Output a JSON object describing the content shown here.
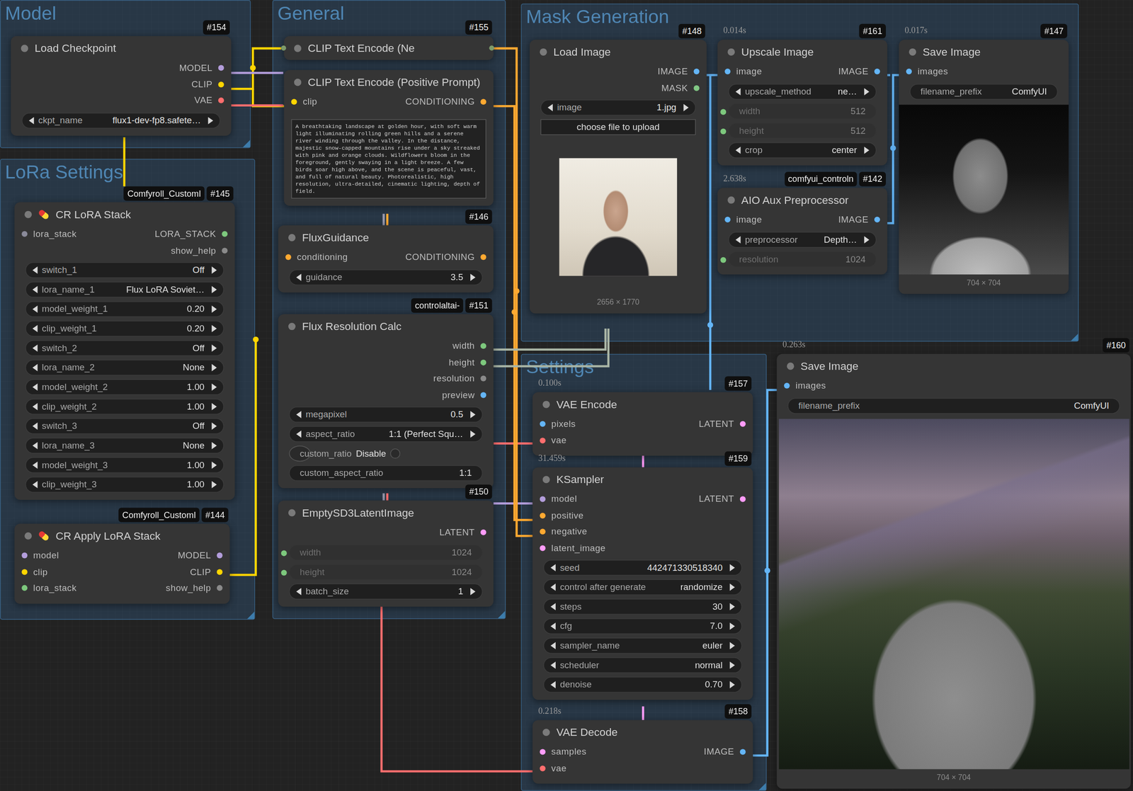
{
  "groups": [
    {
      "title": "Model"
    },
    {
      "title": "LoRa Settings"
    },
    {
      "title": "General"
    },
    {
      "title": "Mask Generation"
    },
    {
      "title": "Settings"
    }
  ],
  "nodes": [
    {
      "id": "#154",
      "title": "Load Checkpoint",
      "time": null,
      "source": null,
      "collapsed": false,
      "hasIcon": false,
      "slots": [
        {
          "in": null,
          "inColor": null,
          "out": "MODEL",
          "outColor": "#b39ddb"
        },
        {
          "in": null,
          "inColor": null,
          "out": "CLIP",
          "outColor": "#ffd500"
        },
        {
          "in": null,
          "inColor": null,
          "out": "VAE",
          "outColor": "#ff6e6e"
        }
      ],
      "widgets": [
        {
          "kind": "combo",
          "label": "ckpt_name",
          "value": "flux1-dev-fp8.safete…"
        }
      ],
      "prompt": null,
      "button": null,
      "image": null
    },
    {
      "id": "#155",
      "title": "CLIP Text Encode (Ne",
      "time": null,
      "source": null,
      "collapsed": true,
      "hasIcon": false,
      "slots": [],
      "widgets": [],
      "prompt": null,
      "button": null,
      "image": null
    },
    {
      "id": null,
      "title": "CLIP Text Encode (Positive Prompt)",
      "time": null,
      "source": null,
      "collapsed": false,
      "hasIcon": false,
      "slots": [
        {
          "in": "clip",
          "inColor": "#ffd500",
          "out": "CONDITIONING",
          "outColor": "#ffa931"
        }
      ],
      "widgets": [],
      "prompt": "A breathtaking landscape at golden hour, with soft warm light illuminating rolling green hills and a serene river winding through the valley. In the distance, majestic snow-capped mountains rise under a sky streaked with pink and orange clouds. Wildflowers bloom in the foreground, gently swaying in a light breeze. A few birds soar high above, and the scene is peaceful, vast, and full of natural beauty. Photorealistic, high resolution, ultra-detailed, cinematic lighting, depth of field.",
      "button": null,
      "image": null
    },
    {
      "id": "#146",
      "title": "FluxGuidance",
      "time": null,
      "source": null,
      "collapsed": false,
      "hasIcon": false,
      "slots": [
        {
          "in": "conditioning",
          "inColor": "#ffa931",
          "out": "CONDITIONING",
          "outColor": "#ffa931"
        }
      ],
      "widgets": [
        {
          "kind": "number",
          "label": "guidance",
          "value": "3.5"
        }
      ],
      "prompt": null,
      "button": null,
      "image": null
    },
    {
      "id": "#151",
      "title": "Flux Resolution Calc",
      "time": null,
      "source": "controlaltai-",
      "collapsed": false,
      "hasIcon": false,
      "slots": [
        {
          "in": null,
          "inColor": null,
          "out": "width",
          "outColor": "#7dc87d"
        },
        {
          "in": null,
          "inColor": null,
          "out": "height",
          "outColor": "#7dc87d"
        },
        {
          "in": null,
          "inColor": null,
          "out": "resolution",
          "outColor": "#8a8a8a"
        },
        {
          "in": null,
          "inColor": null,
          "out": "preview",
          "outColor": "#64b5f6"
        }
      ],
      "widgets": [
        {
          "kind": "number",
          "label": "megapixel",
          "value": "0.5"
        },
        {
          "kind": "combo",
          "label": "aspect_ratio",
          "value": "1:1 (Perfect Squ…"
        },
        {
          "kind": "toggle",
          "label": "custom_ratio",
          "value": "Disable",
          "on": false
        },
        {
          "kind": "text",
          "label": "custom_aspect_ratio",
          "value": "1:1"
        }
      ],
      "prompt": null,
      "button": null,
      "image": null
    },
    {
      "id": "#150",
      "title": "EmptySD3LatentImage",
      "time": null,
      "source": null,
      "collapsed": false,
      "hasIcon": false,
      "slots": [
        {
          "in": null,
          "inColor": null,
          "out": "LATENT",
          "outColor": "#ff9cf9"
        }
      ],
      "widgets": [
        {
          "kind": "input",
          "label": "width",
          "value": "1024"
        },
        {
          "kind": "input",
          "label": "height",
          "value": "1024"
        },
        {
          "kind": "number",
          "label": "batch_size",
          "value": "1"
        }
      ],
      "prompt": null,
      "button": null,
      "image": null
    },
    {
      "id": "#145",
      "title": "CR LoRA Stack",
      "time": null,
      "source": "Comfyroll_CustomI",
      "collapsed": false,
      "hasIcon": true,
      "slots": [
        {
          "in": "lora_stack",
          "inColor": "#8a8a9a",
          "out": "LORA_STACK",
          "outColor": "#7dc87d"
        },
        {
          "in": null,
          "inColor": null,
          "out": "show_help",
          "outColor": "#8a8a8a"
        }
      ],
      "widgets": [
        {
          "kind": "combo",
          "label": "switch_1",
          "value": "Off"
        },
        {
          "kind": "combo",
          "label": "lora_name_1",
          "value": "Flux LoRA Soviet…"
        },
        {
          "kind": "number",
          "label": "model_weight_1",
          "value": "0.20"
        },
        {
          "kind": "number",
          "label": "clip_weight_1",
          "value": "0.20"
        },
        {
          "kind": "combo",
          "label": "switch_2",
          "value": "Off"
        },
        {
          "kind": "combo",
          "label": "lora_name_2",
          "value": "None"
        },
        {
          "kind": "number",
          "label": "model_weight_2",
          "value": "1.00"
        },
        {
          "kind": "number",
          "label": "clip_weight_2",
          "value": "1.00"
        },
        {
          "kind": "combo",
          "label": "switch_3",
          "value": "Off"
        },
        {
          "kind": "combo",
          "label": "lora_name_3",
          "value": "None"
        },
        {
          "kind": "number",
          "label": "model_weight_3",
          "value": "1.00"
        },
        {
          "kind": "number",
          "label": "clip_weight_3",
          "value": "1.00"
        }
      ],
      "prompt": null,
      "button": null,
      "image": null
    },
    {
      "id": "#144",
      "title": "CR Apply LoRA Stack",
      "time": null,
      "source": "Comfyroll_CustomI",
      "collapsed": false,
      "hasIcon": true,
      "slots": [
        {
          "in": "model",
          "inColor": "#b39ddb",
          "out": "MODEL",
          "outColor": "#b39ddb"
        },
        {
          "in": "clip",
          "inColor": "#ffd500",
          "out": "CLIP",
          "outColor": "#ffd500"
        },
        {
          "in": "lora_stack",
          "inColor": "#7dc87d",
          "out": "show_help",
          "outColor": "#8a8a8a"
        }
      ],
      "widgets": [],
      "prompt": null,
      "button": null,
      "image": null
    },
    {
      "id": "#148",
      "title": "Load Image",
      "time": null,
      "source": null,
      "collapsed": false,
      "hasIcon": false,
      "slots": [
        {
          "in": null,
          "inColor": null,
          "out": "IMAGE",
          "outColor": "#64b5f6"
        },
        {
          "in": null,
          "inColor": null,
          "out": "MASK",
          "outColor": "#81c784"
        }
      ],
      "widgets": [
        {
          "kind": "combo",
          "label": "image",
          "value": "1.jpg"
        }
      ],
      "prompt": null,
      "button": "choose file to upload",
      "image": {
        "kind": "photo",
        "caption": "2656 × 1770"
      }
    },
    {
      "id": "#161",
      "title": "Upscale Image",
      "time": "0.014s",
      "source": null,
      "collapsed": false,
      "hasIcon": false,
      "slots": [
        {
          "in": "image",
          "inColor": "#64b5f6",
          "out": "IMAGE",
          "outColor": "#64b5f6"
        }
      ],
      "widgets": [
        {
          "kind": "combo",
          "label": "upscale_method",
          "value": "ne…"
        },
        {
          "kind": "input",
          "label": "width",
          "value": "512"
        },
        {
          "kind": "input",
          "label": "height",
          "value": "512"
        },
        {
          "kind": "combo",
          "label": "crop",
          "value": "center"
        }
      ],
      "prompt": null,
      "button": null,
      "image": null
    },
    {
      "id": "#142",
      "title": "AIO Aux Preprocessor",
      "time": "2.638s",
      "source": "comfyui_controln",
      "collapsed": false,
      "hasIcon": false,
      "slots": [
        {
          "in": "image",
          "inColor": "#64b5f6",
          "out": "IMAGE",
          "outColor": "#64b5f6"
        }
      ],
      "widgets": [
        {
          "kind": "combo",
          "label": "preprocessor",
          "value": "Depth…"
        },
        {
          "kind": "input",
          "label": "resolution",
          "value": "1024"
        }
      ],
      "prompt": null,
      "button": null,
      "image": null
    },
    {
      "id": "#147",
      "title": "Save Image",
      "time": "0.017s",
      "source": null,
      "collapsed": false,
      "hasIcon": false,
      "slots": [
        {
          "in": "images",
          "inColor": "#64b5f6",
          "out": null,
          "outColor": null
        }
      ],
      "widgets": [
        {
          "kind": "text",
          "label": "filename_prefix",
          "value": "ComfyUI"
        }
      ],
      "prompt": null,
      "button": null,
      "image": {
        "kind": "depth",
        "caption": "704 × 704"
      }
    },
    {
      "id": "#157",
      "title": "VAE Encode",
      "time": "0.100s",
      "source": null,
      "collapsed": false,
      "hasIcon": false,
      "slots": [
        {
          "in": "pixels",
          "inColor": "#64b5f6",
          "out": "LATENT",
          "outColor": "#ff9cf9"
        },
        {
          "in": "vae",
          "inColor": "#ff6e6e",
          "out": null,
          "outColor": null
        }
      ],
      "widgets": [],
      "prompt": null,
      "button": null,
      "image": null
    },
    {
      "id": "#159",
      "title": "KSampler",
      "time": "31.459s",
      "source": null,
      "collapsed": false,
      "hasIcon": false,
      "slots": [
        {
          "in": "model",
          "inColor": "#b39ddb",
          "out": "LATENT",
          "outColor": "#ff9cf9"
        },
        {
          "in": "positive",
          "inColor": "#ffa931",
          "out": null,
          "outColor": null
        },
        {
          "in": "negative",
          "inColor": "#ffa931",
          "out": null,
          "outColor": null
        },
        {
          "in": "latent_image",
          "inColor": "#ff9cf9",
          "out": null,
          "outColor": null
        }
      ],
      "widgets": [
        {
          "kind": "number",
          "label": "seed",
          "value": "442471330518340"
        },
        {
          "kind": "combo",
          "label": "control after generate",
          "value": "randomize"
        },
        {
          "kind": "number",
          "label": "steps",
          "value": "30"
        },
        {
          "kind": "number",
          "label": "cfg",
          "value": "7.0"
        },
        {
          "kind": "combo",
          "label": "sampler_name",
          "value": "euler"
        },
        {
          "kind": "combo",
          "label": "scheduler",
          "value": "normal"
        },
        {
          "kind": "number",
          "label": "denoise",
          "value": "0.70"
        }
      ],
      "prompt": null,
      "button": null,
      "image": null
    },
    {
      "id": "#158",
      "title": "VAE Decode",
      "time": "0.218s",
      "source": null,
      "collapsed": false,
      "hasIcon": false,
      "slots": [
        {
          "in": "samples",
          "inColor": "#ff9cf9",
          "out": "IMAGE",
          "outColor": "#64b5f6"
        },
        {
          "in": "vae",
          "inColor": "#ff6e6e",
          "out": null,
          "outColor": null
        }
      ],
      "widgets": [],
      "prompt": null,
      "button": null,
      "image": null
    },
    {
      "id": "#160",
      "title": "Save Image",
      "time": "0.263s",
      "source": null,
      "collapsed": false,
      "hasIcon": false,
      "slots": [
        {
          "in": "images",
          "inColor": "#64b5f6",
          "out": null,
          "outColor": null
        }
      ],
      "widgets": [
        {
          "kind": "text",
          "label": "filename_prefix",
          "value": "ComfyUI"
        }
      ],
      "prompt": null,
      "button": null,
      "image": {
        "kind": "landscape",
        "caption": "704 × 704"
      }
    }
  ]
}
